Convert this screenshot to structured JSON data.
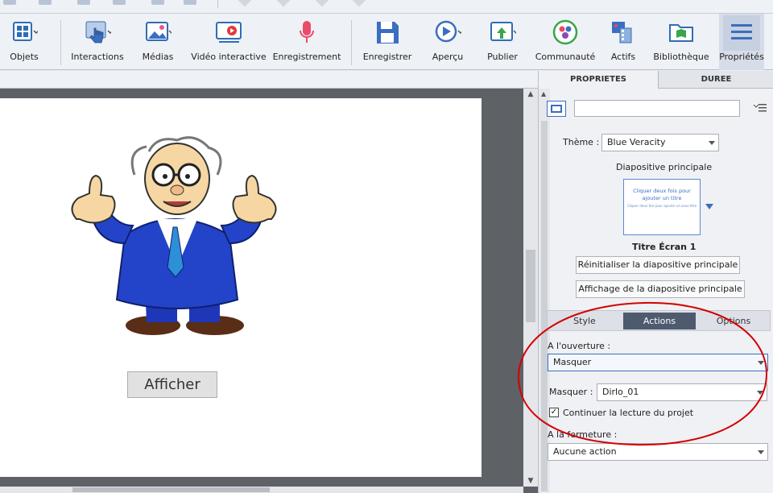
{
  "toolbar": {
    "items": [
      {
        "label": "Objets",
        "icon": "objects-grid-icon"
      },
      {
        "label": "Interactions",
        "icon": "hand-pointer-icon"
      },
      {
        "label": "Médias",
        "icon": "image-icon"
      },
      {
        "label": "Vidéo interactive",
        "icon": "video-play-icon"
      },
      {
        "label": "Enregistrement",
        "icon": "microphone-icon"
      },
      {
        "label": "Enregistrer",
        "icon": "floppy-save-icon"
      },
      {
        "label": "Aperçu",
        "icon": "play-circle-icon"
      },
      {
        "label": "Publier",
        "icon": "publish-upload-icon"
      },
      {
        "label": "Communauté",
        "icon": "community-icon"
      },
      {
        "label": "Actifs",
        "icon": "assets-icon"
      },
      {
        "label": "Bibliothèque",
        "icon": "library-folder-icon"
      },
      {
        "label": "Propriétés",
        "icon": "properties-lines-icon"
      }
    ]
  },
  "stage": {
    "button_label": "Afficher",
    "character": "cartoon-man-thumbs-up"
  },
  "panel": {
    "tabs": [
      "PROPRIETES",
      "DUREE"
    ],
    "name_value": "",
    "theme_label": "Thème :",
    "theme_value": "Blue Veracity",
    "master_slide_heading": "Diapositive principale",
    "master_thumb_title": "Cliquer deux fois pour ajouter un titre",
    "master_thumb_subtitle": "Cliquer deux fois pour ajouter un sous-titre",
    "master_name": "Titre Écran 1",
    "reset_button": "Réinitialiser la diapositive principale",
    "show_button": "Affichage de la diapositive principale",
    "subtabs": [
      "Style",
      "Actions",
      "Options"
    ],
    "on_enter_label": "A l'ouverture :",
    "on_enter_value": "Masquer",
    "hide_label": "Masquer :",
    "hide_value": "Dirlo_01",
    "continue_label": "Continuer la lecture du projet",
    "continue_checked": "✓",
    "on_exit_label": "A la fermeture :",
    "on_exit_value": "Aucune action"
  },
  "colors": {
    "accent": "#3a6ec0",
    "annotation": "#d40000"
  }
}
